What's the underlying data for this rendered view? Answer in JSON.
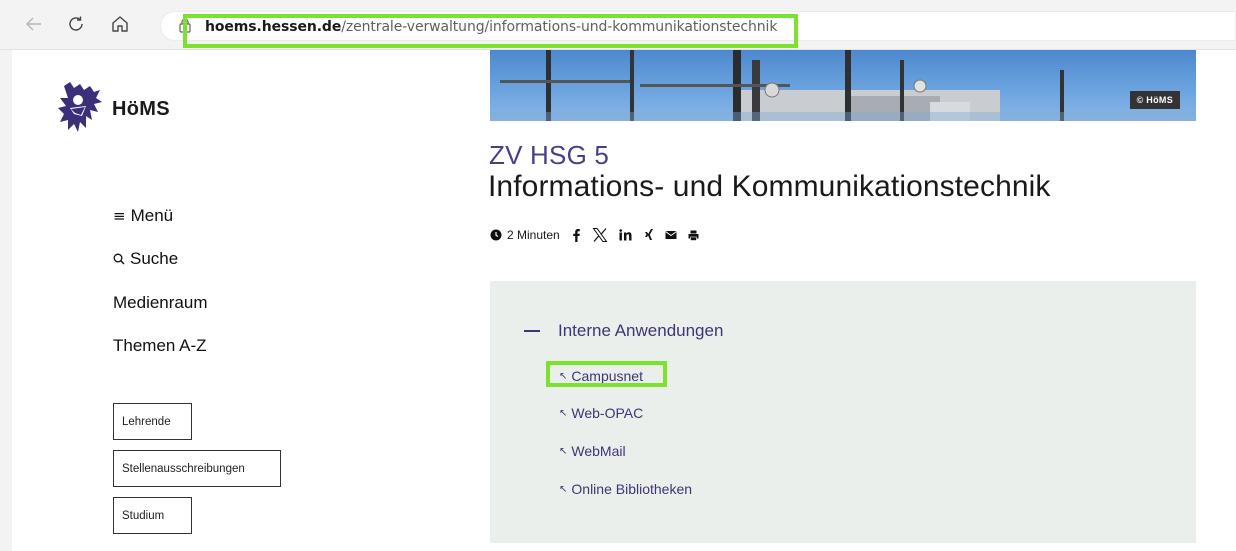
{
  "browser": {
    "url_host": "hoems.hessen.de",
    "url_path": "/zentrale-verwaltung/informations-und-kommunikationstechnik"
  },
  "site": {
    "brand": "HöMS"
  },
  "sidebar": {
    "menu_label": "Menü",
    "search_label": "Suche",
    "media_label": "Medienraum",
    "themes_label": "Themen A-Z",
    "buttons": [
      "Lehrende",
      "Stellenausschreibungen",
      "Studium"
    ]
  },
  "hero": {
    "copyright": "© HöMS"
  },
  "article": {
    "code": "ZV HSG 5",
    "title": "Informations- und Kommunikationstechnik",
    "reading_time": "2 Minuten"
  },
  "accordion": {
    "heading": "Interne Anwendungen",
    "links": [
      "Campusnet",
      "Web-OPAC",
      "WebMail",
      "Online Bibliotheken"
    ]
  },
  "colors": {
    "highlight": "#7be22d",
    "accent": "#4c3f88",
    "accordion_bg": "#ebefeb"
  },
  "icons": [
    "back-icon",
    "reload-icon",
    "home-icon",
    "lock-icon",
    "clock-icon",
    "facebook-icon",
    "x-icon",
    "linkedin-icon",
    "xing-icon",
    "mail-icon",
    "print-icon",
    "external-link-icon",
    "hamburger-icon",
    "search-icon",
    "lion-logo-icon"
  ]
}
